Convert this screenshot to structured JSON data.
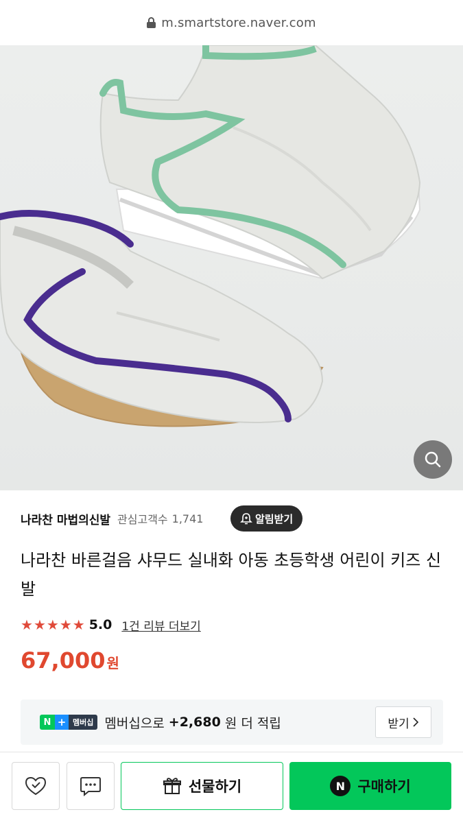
{
  "browser": {
    "url": "m.smartstore.naver.com"
  },
  "store": {
    "name": "나라찬 마법의신발",
    "follower_label": "관심고객수",
    "follower_count": "1,741",
    "alarm_label": "알림받기"
  },
  "product": {
    "title": "나라찬 바른걸음 샤무드 실내화 아동 초등학생 어린이 키즈 신발",
    "rating": {
      "stars": 5,
      "value": "5.0",
      "review_link": "1건 리뷰 더보기"
    },
    "price": "67,000",
    "price_unit": "원"
  },
  "membership": {
    "badge_n": "N",
    "badge_plus": "+",
    "badge_label": "멤버십",
    "text": "멤버십으로",
    "points": "+2,680",
    "suffix": "원 더 적립",
    "receive_label": "받기"
  },
  "bottom_bar": {
    "gift_label": "선물하기",
    "buy_icon": "N",
    "buy_label": "구매하기"
  },
  "colors": {
    "naver_green": "#03c75a",
    "price_red": "#e0482f",
    "star_red": "#e04a3a"
  }
}
